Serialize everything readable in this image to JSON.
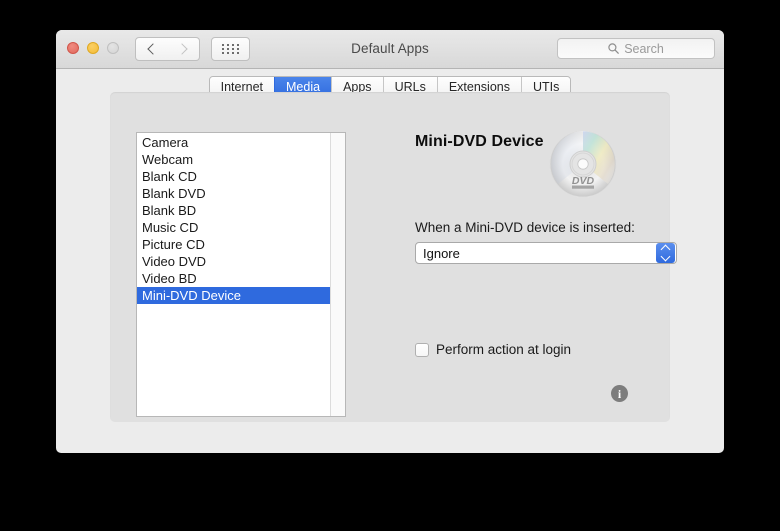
{
  "window": {
    "title": "Default Apps",
    "traffic_lights": {
      "close": "close-button",
      "minimize": "minimize-button",
      "zoom": "zoom-button"
    },
    "toolbar": {
      "back_icon": "chevron-left-icon",
      "forward_icon": "chevron-right-icon",
      "show_all_icon": "grid-dots-icon",
      "search": {
        "placeholder": "Search",
        "value": "",
        "icon": "search-icon"
      }
    }
  },
  "tabs": [
    {
      "label": "Internet",
      "selected": false
    },
    {
      "label": "Media",
      "selected": true
    },
    {
      "label": "Apps",
      "selected": false
    },
    {
      "label": "URLs",
      "selected": false
    },
    {
      "label": "Extensions",
      "selected": false
    },
    {
      "label": "UTIs",
      "selected": false
    }
  ],
  "media_list": {
    "items": [
      {
        "label": "Camera",
        "selected": false
      },
      {
        "label": "Webcam",
        "selected": false
      },
      {
        "label": "Blank CD",
        "selected": false
      },
      {
        "label": "Blank DVD",
        "selected": false
      },
      {
        "label": "Blank BD",
        "selected": false
      },
      {
        "label": "Music CD",
        "selected": false
      },
      {
        "label": "Picture CD",
        "selected": false
      },
      {
        "label": "Video DVD",
        "selected": false
      },
      {
        "label": "Video BD",
        "selected": false
      },
      {
        "label": "Mini-DVD Device",
        "selected": true
      }
    ]
  },
  "detail": {
    "title": "Mini-DVD Device",
    "icon": "dvd-disc-icon",
    "insert_label": "When a Mini-DVD device is inserted:",
    "action_popup": {
      "value": "Ignore",
      "stepper_icon": "chevron-up-down-icon"
    },
    "login_checkbox": {
      "label": "Perform action at login",
      "checked": false
    },
    "info_button": {
      "glyph": "i",
      "name": "info-icon"
    }
  },
  "colors": {
    "accent": "#2f6ade",
    "window_bg": "#ececec",
    "panel_bg": "#e0e0e0",
    "selection": "#2f6ade",
    "info_gray": "#7d7d7d"
  }
}
